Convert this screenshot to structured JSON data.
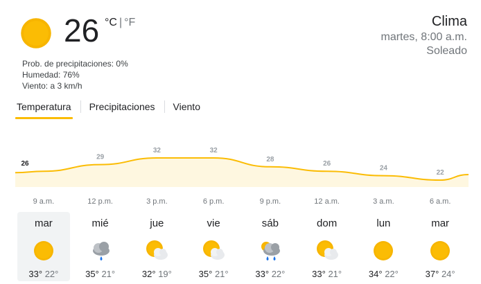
{
  "current": {
    "temperature": "26",
    "unit_c": "°C",
    "unit_f": "°F",
    "unit_sep": "|",
    "icon": "sun-icon",
    "precip_label": "Prob. de precipitaciones: 0%",
    "humidity_label": "Humedad: 76%",
    "wind_label": "Viento: a 3 km/h"
  },
  "header": {
    "title": "Clima",
    "datetime": "martes, 8:00 a.m.",
    "condition": "Soleado"
  },
  "tabs": [
    {
      "label": "Temperatura",
      "active": true
    },
    {
      "label": "Precipitaciones",
      "active": false
    },
    {
      "label": "Viento",
      "active": false
    }
  ],
  "chart_data": {
    "type": "area",
    "x": [
      "9 a.m.",
      "12 p.m.",
      "3 p.m.",
      "6 p.m.",
      "9 p.m.",
      "12 a.m.",
      "3 a.m.",
      "6 a.m."
    ],
    "values": [
      26,
      29,
      32,
      32,
      28,
      26,
      24,
      22
    ],
    "labels": [
      "26",
      "29",
      "32",
      "32",
      "28",
      "26",
      "24",
      "22"
    ],
    "line_color": "#fbbc04",
    "fill_color": "#fef7e0",
    "grid": false
  },
  "forecast": [
    {
      "day": "mar",
      "icon": "sun-icon",
      "high": "33°",
      "low": "22°",
      "selected": true
    },
    {
      "day": "mié",
      "icon": "rain-cloud-icon",
      "high": "35°",
      "low": "21°",
      "selected": false
    },
    {
      "day": "jue",
      "icon": "partly-cloudy-icon",
      "high": "32°",
      "low": "19°",
      "selected": false
    },
    {
      "day": "vie",
      "icon": "partly-cloudy-icon",
      "high": "35°",
      "low": "21°",
      "selected": false
    },
    {
      "day": "sáb",
      "icon": "thunderstorm-icon",
      "high": "33°",
      "low": "22°",
      "selected": false
    },
    {
      "day": "dom",
      "icon": "partly-cloudy-icon",
      "high": "33°",
      "low": "21°",
      "selected": false
    },
    {
      "day": "lun",
      "icon": "sun-icon",
      "high": "34°",
      "low": "22°",
      "selected": false
    },
    {
      "day": "mar",
      "icon": "sun-icon",
      "high": "37°",
      "low": "24°",
      "selected": false
    }
  ]
}
